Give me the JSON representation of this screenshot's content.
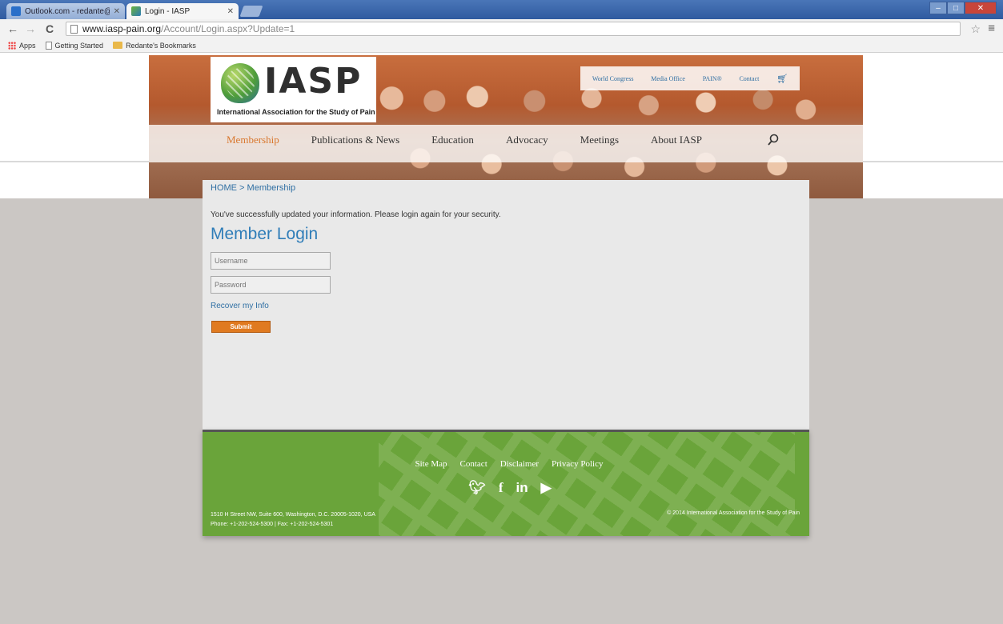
{
  "browser": {
    "tabs": [
      {
        "title": "Outlook.com - redante@",
        "active": false
      },
      {
        "title": "Login - IASP",
        "active": true
      }
    ],
    "url_host": "www.iasp-pain.org",
    "url_path": "/Account/Login.aspx?Update=1",
    "bookmarks": [
      "Apps",
      "Getting Started",
      "Redante's Bookmarks"
    ]
  },
  "site": {
    "logo_text": "IASP",
    "logo_subtitle": "International Association for the Study of Pain",
    "utility_nav": [
      "World Congress",
      "Media Office",
      "PAIN®",
      "Contact"
    ],
    "main_nav": [
      "Membership",
      "Publications & News",
      "Education",
      "Advocacy",
      "Meetings",
      "About IASP"
    ]
  },
  "content": {
    "breadcrumb": "HOME > Membership",
    "message": "You've successfully updated your information. Please login again for your security.",
    "title": "Member Login",
    "username_placeholder": "Username",
    "password_placeholder": "Password",
    "recover_label": "Recover my Info",
    "submit_label": "Submit"
  },
  "footer": {
    "links": [
      "Site Map",
      "Contact",
      "Disclaimer",
      "Privacy Policy"
    ],
    "social_icons": [
      "twitter-icon",
      "facebook-icon",
      "linkedin-icon",
      "youtube-icon"
    ],
    "address_line1": "1510 H Street NW, Suite 600, Washington, D.C. 20005-1020, USA",
    "address_line2": "Phone: +1-202-524-5300 | Fax: +1-202-524-5301",
    "copyright": "© 2014 International Association for the Study of Pain"
  },
  "colors": {
    "accent_orange": "#e07a20",
    "link_blue": "#2f6fa3",
    "footer_green": "#6aa43a"
  }
}
